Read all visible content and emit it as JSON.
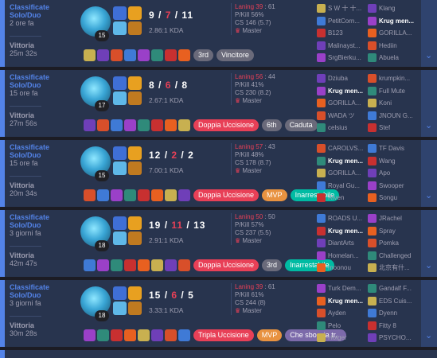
{
  "matches": [
    {
      "queue": "Classificate Solo/Duo",
      "ago": "2 ore fa",
      "result": "Vittoria",
      "duration": "25m 32s",
      "level": "15",
      "k": "9",
      "d": "7",
      "a": "11",
      "kda_ratio": "2.86:1 KDA",
      "laning": "Laning 39",
      "laning_opp": "61",
      "pkill": "P/Kill 56%",
      "cs": "CS 146 (5.7)",
      "rank": "Master",
      "tags": [
        {
          "label": "3rd",
          "style": "t-gray"
        },
        {
          "label": "Vincitore",
          "style": "t-gray"
        }
      ],
      "team_left": [
        "S W 十 十...",
        "PetitCorn...",
        "B123",
        "Malinayst...",
        "SrgBierku..."
      ],
      "team_right": [
        "Klang",
        "Krug men...",
        "GORILLA...",
        "Hediin",
        "Abuela"
      ],
      "me_right": 1
    },
    {
      "queue": "Classificate Solo/Duo",
      "ago": "15 ore fa",
      "result": "Vittoria",
      "duration": "27m 56s",
      "level": "17",
      "k": "8",
      "d": "6",
      "a": "8",
      "kda_ratio": "2.67:1 KDA",
      "laning": "Laning 56",
      "laning_opp": "44",
      "pkill": "P/Kill 41%",
      "cs": "CS 230 (8.2)",
      "rank": "Master",
      "tags": [
        {
          "label": "Doppia Uccisione",
          "style": "t-multi"
        },
        {
          "label": "6th",
          "style": "t-gray"
        },
        {
          "label": "Caduta",
          "style": "t-gray"
        }
      ],
      "team_left": [
        "Dziuba",
        "Krug men...",
        "GORILLA...",
        "WADA ツ",
        "celsius"
      ],
      "team_right": [
        "krumpkin...",
        "Full Mute",
        "Koni",
        "JNOUN G...",
        "Stef"
      ],
      "me_left": 1
    },
    {
      "queue": "Classificate Solo/Duo",
      "ago": "15 ore fa",
      "result": "Vittoria",
      "duration": "20m 34s",
      "level": "15",
      "k": "12",
      "d": "2",
      "a": "2",
      "kda_ratio": "7.00:1 KDA",
      "laning": "Laning 57",
      "laning_opp": "43",
      "pkill": "P/Kill 48%",
      "cs": "CS 178 (8.7)",
      "rank": "Master",
      "tags": [
        {
          "label": "Doppia Uccisione",
          "style": "t-multi"
        },
        {
          "label": "MVP",
          "style": "t-mvp"
        },
        {
          "label": "Inarrestabile",
          "style": "t-green"
        }
      ],
      "team_left": [
        "CAROLVS...",
        "Krug men...",
        "GORILLA...",
        "Royal Gu...",
        "Riven"
      ],
      "team_right": [
        "TF Davis",
        "Wang",
        "Apo",
        "Swooper",
        "Songu"
      ],
      "me_left": 1
    },
    {
      "queue": "Classificate Solo/Duo",
      "ago": "3 giorni fa",
      "result": "Vittoria",
      "duration": "42m 47s",
      "level": "18",
      "k": "19",
      "d": "11",
      "a": "13",
      "kda_ratio": "2.91:1 KDA",
      "laning": "Laning 50",
      "laning_opp": "50",
      "pkill": "P/Kill 57%",
      "cs": "CS 237 (5.5)",
      "rank": "Master",
      "tags": [
        {
          "label": "Doppia Uccisione",
          "style": "t-multi"
        },
        {
          "label": "3rd",
          "style": "t-gray"
        },
        {
          "label": "Inarrestabile",
          "style": "t-green"
        }
      ],
      "team_left": [
        "ROADS U...",
        "Krug men...",
        "DiantArts",
        "Homelan...",
        "moonou"
      ],
      "team_right": [
        "JRachel",
        "Spray",
        "Pomka",
        "Challenged",
        "北京有什..."
      ],
      "me_left": 1
    },
    {
      "queue": "Classificate Solo/Duo",
      "ago": "3 giorni fa",
      "result": "Vittoria",
      "duration": "30m 28s",
      "level": "18",
      "k": "15",
      "d": "6",
      "a": "5",
      "kda_ratio": "3.33:1 KDA",
      "laning": "Laning 39",
      "laning_opp": "61",
      "pkill": "P/Kill 61%",
      "cs": "CS 244 (8)",
      "rank": "Master",
      "tags": [
        {
          "label": "Tripla Uccisione",
          "style": "t-multi"
        },
        {
          "label": "MVP",
          "style": "t-mvp"
        },
        {
          "label": "Che sboccia tr...",
          "style": "t-purple"
        }
      ],
      "team_left": [
        "Turk Dem...",
        "Krug men...",
        "Ayden",
        "Pelo",
        "Holger"
      ],
      "team_right": [
        "Gandalf F...",
        "EDS Cuis...",
        "Dyenn",
        "Fitty 8",
        "PSYCHO..."
      ],
      "me_left": 1
    }
  ],
  "icons": {
    "spell_colors": [
      "#3f6fd6",
      "#e8a020",
      "#5fb8e8",
      "#c07a20"
    ],
    "item_colors": [
      "#c8b050",
      "#6f3fb8",
      "#d84f2a",
      "#3f7ad6",
      "#9a40c8",
      "#2f8a7a",
      "#c83030",
      "#e86020"
    ],
    "expand": "chevron-down-icon"
  }
}
